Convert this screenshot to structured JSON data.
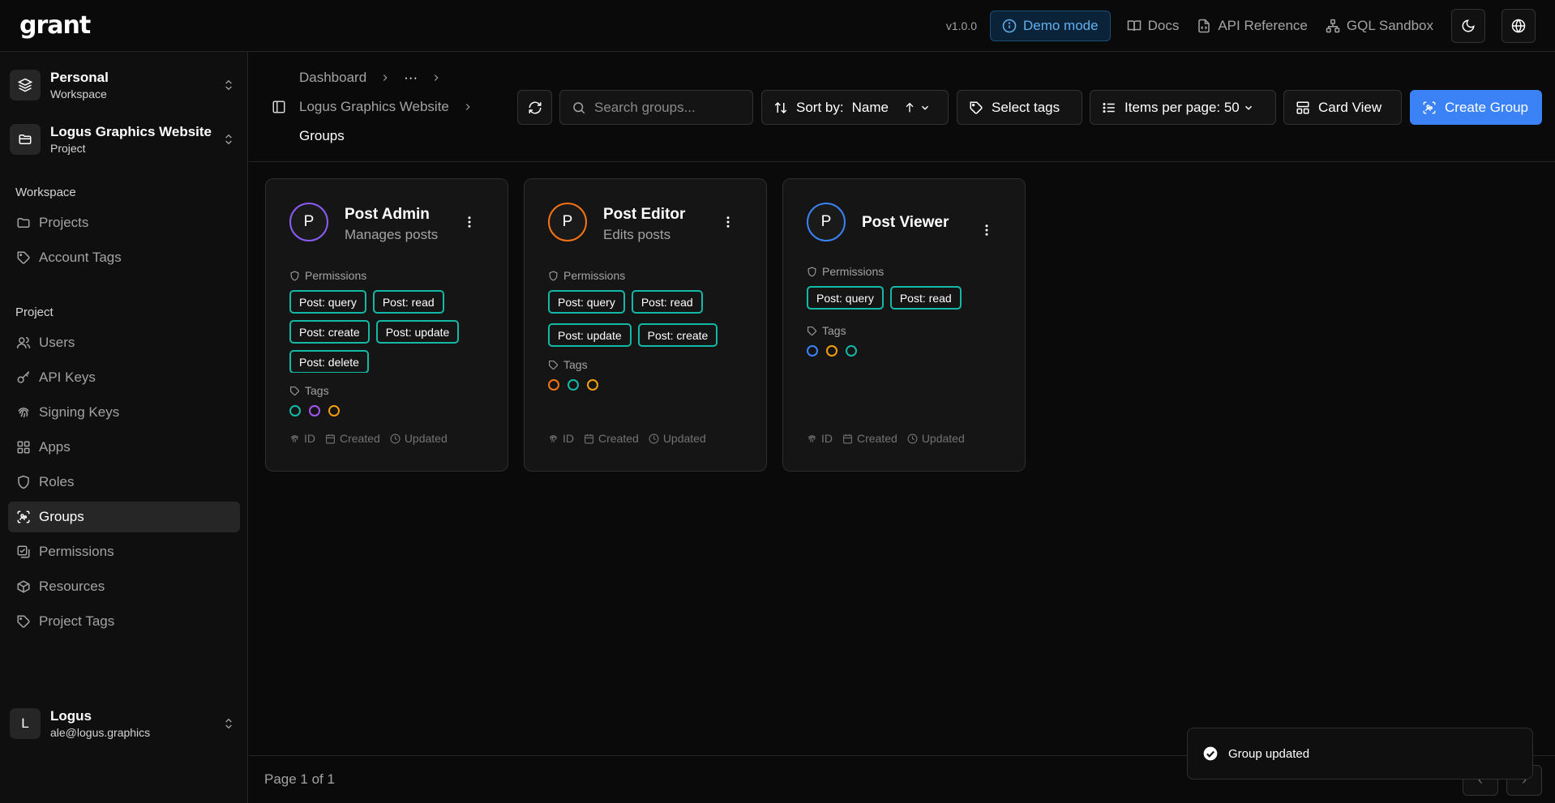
{
  "app": {
    "logo": "grant",
    "version": "v1.0.0"
  },
  "topnav": {
    "demo_mode": "Demo mode",
    "docs": "Docs",
    "api_reference": "API Reference",
    "gql_sandbox": "GQL Sandbox"
  },
  "sidebar": {
    "workspace_switcher": {
      "title": "Personal",
      "subtitle": "Workspace"
    },
    "project_switcher": {
      "title": "Logus Graphics Website",
      "subtitle": "Project"
    },
    "workspace_section": "Workspace",
    "workspace_items": [
      {
        "label": "Projects",
        "icon": "folder-icon"
      },
      {
        "label": "Account Tags",
        "icon": "tag-icon"
      }
    ],
    "project_section": "Project",
    "project_items": [
      {
        "label": "Users",
        "icon": "users-icon"
      },
      {
        "label": "API Keys",
        "icon": "key-icon"
      },
      {
        "label": "Signing Keys",
        "icon": "fingerprint-icon"
      },
      {
        "label": "Apps",
        "icon": "grid-icon"
      },
      {
        "label": "Roles",
        "icon": "shield-icon"
      },
      {
        "label": "Groups",
        "icon": "group-icon",
        "active": true
      },
      {
        "label": "Permissions",
        "icon": "check-square-icon"
      },
      {
        "label": "Resources",
        "icon": "box-icon"
      },
      {
        "label": "Project Tags",
        "icon": "tag-icon"
      }
    ],
    "user": {
      "initial": "L",
      "name": "Logus",
      "email": "ale@logus.graphics"
    }
  },
  "breadcrumb": {
    "dashboard": "Dashboard",
    "ellipsis": "···",
    "project": "Logus Graphics Website",
    "current": "Groups"
  },
  "toolbar": {
    "search_placeholder": "Search groups...",
    "sort_prefix": "Sort by:",
    "sort_value": "Name",
    "select_tags": "Select tags",
    "items_per_page": "Items per page: 50",
    "view": "Card View",
    "create": "Create Group"
  },
  "labels": {
    "permissions": "Permissions",
    "tags": "Tags",
    "id": "ID",
    "created": "Created",
    "updated": "Updated"
  },
  "groups": [
    {
      "initial": "P",
      "name": "Post Admin",
      "description": "Manages posts",
      "avatar_color": "#8b5cf6",
      "permissions": [
        "Post: query",
        "Post: read",
        "Post: create",
        "Post: update",
        "Post: delete"
      ],
      "tag_colors": [
        "#14b8a6",
        "#a855f7",
        "#f59e0b"
      ]
    },
    {
      "initial": "P",
      "name": "Post Editor",
      "description": "Edits posts",
      "avatar_color": "#f97316",
      "permissions": [
        "Post: query",
        "Post: read",
        "Post: update",
        "Post: create"
      ],
      "tag_colors": [
        "#f97316",
        "#14b8a6",
        "#f59e0b"
      ]
    },
    {
      "initial": "P",
      "name": "Post Viewer",
      "description": "",
      "avatar_color": "#3b82f6",
      "permissions": [
        "Post: query",
        "Post: read"
      ],
      "tag_colors": [
        "#3b82f6",
        "#f59e0b",
        "#14b8a6"
      ]
    }
  ],
  "footer": {
    "page": "Page 1 of 1"
  },
  "toast": {
    "message": "Group updated"
  }
}
